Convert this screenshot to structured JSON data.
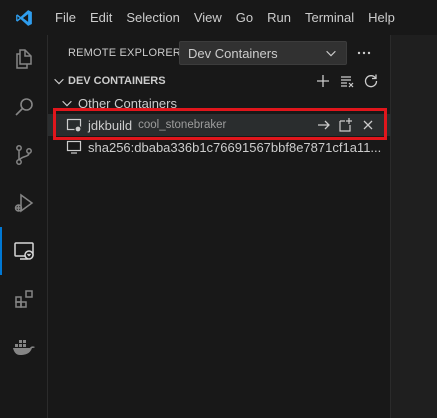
{
  "menu": [
    "File",
    "Edit",
    "Selection",
    "View",
    "Go",
    "Run",
    "Terminal",
    "Help"
  ],
  "sidebar": {
    "title": "REMOTE EXPLORER",
    "dropdown_value": "Dev Containers",
    "section_title": "DEV CONTAINERS",
    "group_label": "Other Containers",
    "container": {
      "name": "jdkbuild",
      "description": "cool_stonebraker"
    },
    "image_label": "sha256:dbaba336b1c76691567bbf8e7871cf1a11..."
  },
  "colors": {
    "accent": "#0078d4",
    "highlight": "#e0161c",
    "background": "#1f1f1f",
    "sidebar": "#181818"
  },
  "icons": {
    "activity": [
      "explorer-icon",
      "search-icon",
      "source-control-icon",
      "run-debug-icon",
      "remote-explorer-icon",
      "extensions-icon",
      "docker-icon"
    ],
    "section_actions": [
      "new-container-icon",
      "clear-all-icon",
      "refresh-icon"
    ],
    "row_actions": [
      "arrow-right-icon",
      "new-window-icon",
      "close-icon"
    ]
  }
}
